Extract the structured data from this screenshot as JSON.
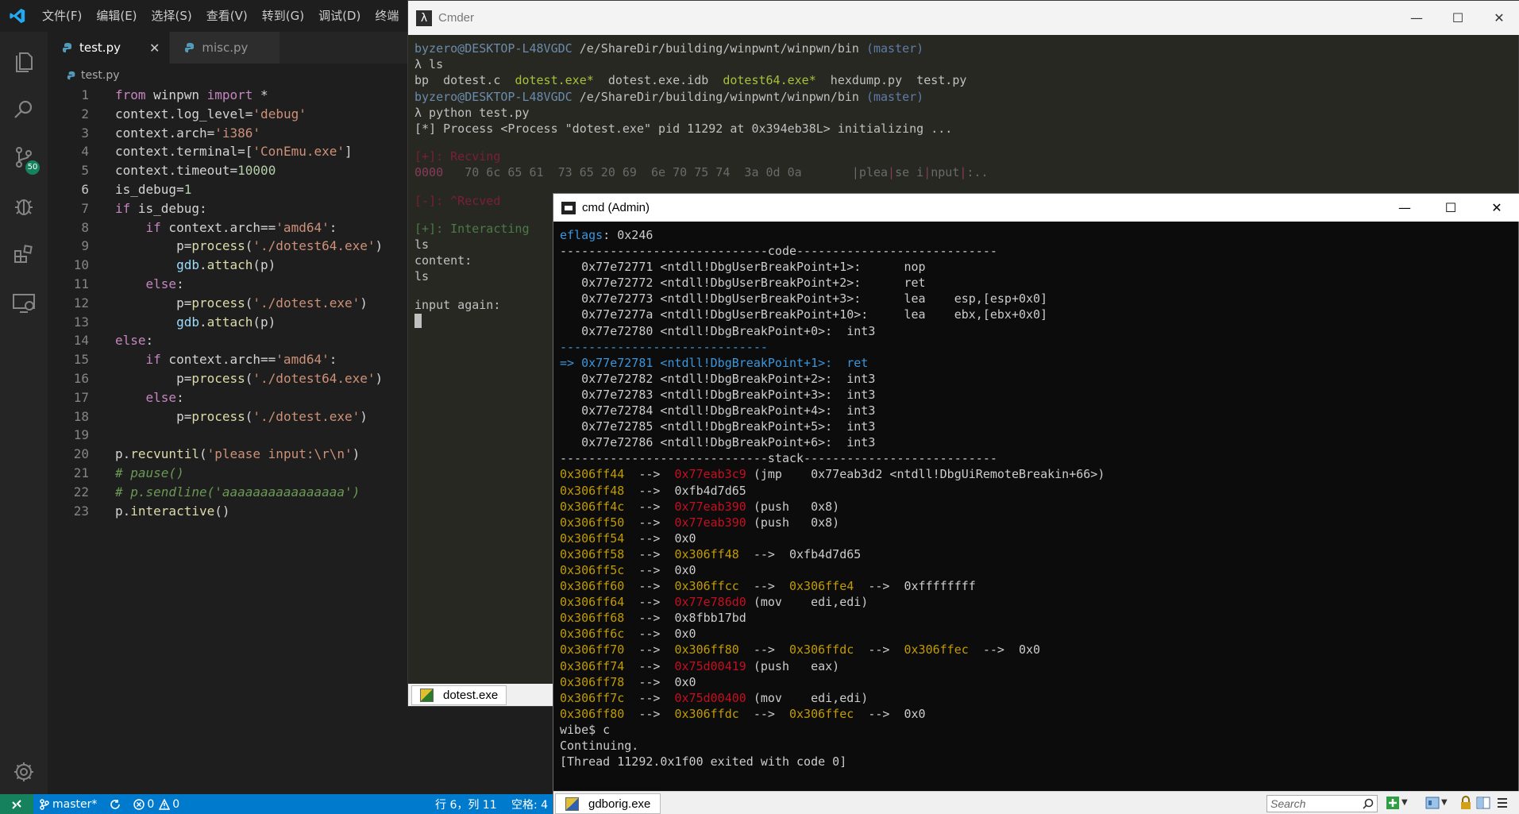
{
  "vscode": {
    "menu": [
      "文件(F)",
      "编辑(E)",
      "选择(S)",
      "查看(V)",
      "转到(G)",
      "调试(D)",
      "终端"
    ],
    "tabs": [
      {
        "label": "test.py",
        "active": true
      },
      {
        "label": "misc.py",
        "active": false
      }
    ],
    "breadcrumb": "test.py",
    "scm_badge": "50",
    "line_numbers": [
      "1",
      "2",
      "3",
      "4",
      "5",
      "6",
      "7",
      "8",
      "9",
      "10",
      "11",
      "12",
      "13",
      "14",
      "15",
      "16",
      "17",
      "18",
      "19",
      "20",
      "21",
      "22",
      "23"
    ],
    "current_line": "6",
    "status": {
      "branch": "master*",
      "errors": "0",
      "warnings": "0",
      "position": "行 6，列 11",
      "spaces": "空格: 4"
    }
  },
  "cmder": {
    "title": "Cmder",
    "lines": [
      {
        "segs": [
          [
            "byzero@DESKTOP-L48VGDC",
            "cg"
          ],
          [
            " /e/ShareDir/building/winpwnt/winpwn/bin ",
            "cpath"
          ],
          [
            "(master)",
            "cbranch"
          ]
        ]
      },
      {
        "segs": [
          [
            "λ ls",
            ""
          ]
        ]
      },
      {
        "segs": [
          [
            "bp  dotest.c  ",
            ""
          ],
          [
            "dotest.exe*",
            "cexe"
          ],
          [
            "  dotest.exe.idb  ",
            ""
          ],
          [
            "dotest64.exe*",
            "cexe"
          ],
          [
            "  hexdump.py  test.py",
            ""
          ]
        ]
      },
      {
        "segs": [
          [
            "byzero@DESKTOP-L48VGDC",
            "cg"
          ],
          [
            " /e/ShareDir/building/winpwnt/winpwn/bin ",
            "cpath"
          ],
          [
            "(master)",
            "cbranch"
          ]
        ]
      },
      {
        "segs": [
          [
            "λ python test.py",
            ""
          ]
        ]
      },
      {
        "segs": [
          [
            "[*] Process <Process \"dotest.exe\" pid 11292 at 0x394eb38L> initializing ...",
            ""
          ]
        ]
      },
      {
        "segs": [
          [
            "",
            ""
          ]
        ]
      },
      {
        "segs": [
          [
            "[+]: Recving",
            "cred"
          ]
        ]
      },
      {
        "segs": [
          [
            "0000   ",
            "cpink"
          ],
          [
            "70 6c 65 61  73 65 20 69  6e 70 75 74  3a 0d 0a",
            "cdim"
          ],
          [
            "       |",
            "cdim"
          ],
          [
            "plea",
            "cdim"
          ],
          [
            "|",
            "cpink"
          ],
          [
            "se i",
            "cdim"
          ],
          [
            "|",
            "cpink"
          ],
          [
            "nput",
            "cdim"
          ],
          [
            "|",
            "cpink"
          ],
          [
            ":..",
            "cdim"
          ]
        ]
      },
      {
        "segs": [
          [
            "",
            ""
          ]
        ]
      },
      {
        "segs": [
          [
            "[-]: ^Recved",
            "cred"
          ]
        ]
      },
      {
        "segs": [
          [
            "",
            ""
          ]
        ]
      },
      {
        "segs": [
          [
            "[+]: Interacting",
            "cgr"
          ]
        ]
      },
      {
        "segs": [
          [
            "ls",
            ""
          ]
        ]
      },
      {
        "segs": [
          [
            "content:",
            ""
          ]
        ]
      },
      {
        "segs": [
          [
            "ls",
            ""
          ]
        ]
      },
      {
        "segs": [
          [
            "",
            ""
          ]
        ]
      },
      {
        "segs": [
          [
            "input again:",
            ""
          ]
        ]
      }
    ],
    "tab_label": "dotest.exe"
  },
  "cmd": {
    "title": "cmd (Admin)",
    "lines": [
      {
        "segs": [
          [
            "eflags",
            "gblue"
          ],
          [
            ": 0x246",
            ""
          ]
        ]
      },
      {
        "segs": [
          [
            "-----------------------------code----------------------------",
            ""
          ]
        ]
      },
      {
        "segs": [
          [
            "   0x77e72771 <ntdll!DbgUserBreakPoint+1>:      nop",
            ""
          ]
        ]
      },
      {
        "segs": [
          [
            "   0x77e72772 <ntdll!DbgUserBreakPoint+2>:      ret",
            ""
          ]
        ]
      },
      {
        "segs": [
          [
            "   0x77e72773 <ntdll!DbgUserBreakPoint+3>:      lea    esp,[esp+0x0]",
            ""
          ]
        ]
      },
      {
        "segs": [
          [
            "   0x77e7277a <ntdll!DbgUserBreakPoint+10>:     lea    ebx,[ebx+0x0]",
            ""
          ]
        ]
      },
      {
        "segs": [
          [
            "   0x77e72780 <ntdll!DbgBreakPoint+0>:  int3",
            ""
          ]
        ]
      },
      {
        "segs": [
          [
            "-----------------------------",
            "gblue"
          ]
        ]
      },
      {
        "segs": [
          [
            "=> 0x77e72781 <ntdll!DbgBreakPoint+1>:  ret",
            "gcy"
          ]
        ]
      },
      {
        "segs": [
          [
            "   0x77e72782 <ntdll!DbgBreakPoint+2>:  int3",
            ""
          ]
        ]
      },
      {
        "segs": [
          [
            "   0x77e72783 <ntdll!DbgBreakPoint+3>:  int3",
            ""
          ]
        ]
      },
      {
        "segs": [
          [
            "   0x77e72784 <ntdll!DbgBreakPoint+4>:  int3",
            ""
          ]
        ]
      },
      {
        "segs": [
          [
            "   0x77e72785 <ntdll!DbgBreakPoint+5>:  int3",
            ""
          ]
        ]
      },
      {
        "segs": [
          [
            "   0x77e72786 <ntdll!DbgBreakPoint+6>:  int3",
            ""
          ]
        ]
      },
      {
        "segs": [
          [
            "-----------------------------stack---------------------------",
            ""
          ]
        ]
      },
      {
        "segs": [
          [
            "0x306ff44",
            "gy"
          ],
          [
            "  -->  ",
            ""
          ],
          [
            "0x77eab3c9",
            "gr"
          ],
          [
            " (jmp    0x77eab3d2 <ntdll!DbgUiRemoteBreakin+66>)",
            ""
          ]
        ]
      },
      {
        "segs": [
          [
            "0x306ff48",
            "gy"
          ],
          [
            "  -->  0xfb4d7d65",
            ""
          ]
        ]
      },
      {
        "segs": [
          [
            "0x306ff4c",
            "gy"
          ],
          [
            "  -->  ",
            ""
          ],
          [
            "0x77eab390",
            "gr"
          ],
          [
            " (push   0x8)",
            ""
          ]
        ]
      },
      {
        "segs": [
          [
            "0x306ff50",
            "gy"
          ],
          [
            "  -->  ",
            ""
          ],
          [
            "0x77eab390",
            "gr"
          ],
          [
            " (push   0x8)",
            ""
          ]
        ]
      },
      {
        "segs": [
          [
            "0x306ff54",
            "gy"
          ],
          [
            "  -->  0x0",
            ""
          ]
        ]
      },
      {
        "segs": [
          [
            "0x306ff58",
            "gy"
          ],
          [
            "  -->  ",
            ""
          ],
          [
            "0x306ff48",
            "gy"
          ],
          [
            "  -->  0xfb4d7d65",
            ""
          ]
        ]
      },
      {
        "segs": [
          [
            "0x306ff5c",
            "gy"
          ],
          [
            "  -->  0x0",
            ""
          ]
        ]
      },
      {
        "segs": [
          [
            "0x306ff60",
            "gy"
          ],
          [
            "  -->  ",
            ""
          ],
          [
            "0x306ffcc",
            "gy"
          ],
          [
            "  -->  ",
            ""
          ],
          [
            "0x306ffe4",
            "gy"
          ],
          [
            "  -->  0xffffffff",
            ""
          ]
        ]
      },
      {
        "segs": [
          [
            "0x306ff64",
            "gy"
          ],
          [
            "  -->  ",
            ""
          ],
          [
            "0x77e786d0",
            "gr"
          ],
          [
            " (mov    edi,edi)",
            ""
          ]
        ]
      },
      {
        "segs": [
          [
            "0x306ff68",
            "gy"
          ],
          [
            "  -->  0x8fbb17bd",
            ""
          ]
        ]
      },
      {
        "segs": [
          [
            "0x306ff6c",
            "gy"
          ],
          [
            "  -->  0x0",
            ""
          ]
        ]
      },
      {
        "segs": [
          [
            "0x306ff70",
            "gy"
          ],
          [
            "  -->  ",
            ""
          ],
          [
            "0x306ff80",
            "gy"
          ],
          [
            "  -->  ",
            ""
          ],
          [
            "0x306ffdc",
            "gy"
          ],
          [
            "  -->  ",
            ""
          ],
          [
            "0x306ffec",
            "gy"
          ],
          [
            "  -->  0x0",
            ""
          ]
        ]
      },
      {
        "segs": [
          [
            "0x306ff74",
            "gy"
          ],
          [
            "  -->  ",
            ""
          ],
          [
            "0x75d00419",
            "gr"
          ],
          [
            " (push   eax)",
            ""
          ]
        ]
      },
      {
        "segs": [
          [
            "0x306ff78",
            "gy"
          ],
          [
            "  -->  0x0",
            ""
          ]
        ]
      },
      {
        "segs": [
          [
            "0x306ff7c",
            "gy"
          ],
          [
            "  -->  ",
            ""
          ],
          [
            "0x75d00400",
            "gr"
          ],
          [
            " (mov    edi,edi)",
            ""
          ]
        ]
      },
      {
        "segs": [
          [
            "0x306ff80",
            "gy"
          ],
          [
            "  -->  ",
            ""
          ],
          [
            "0x306ffdc",
            "gy"
          ],
          [
            "  -->  ",
            ""
          ],
          [
            "0x306ffec",
            "gy"
          ],
          [
            "  -->  0x0",
            ""
          ]
        ]
      },
      {
        "segs": [
          [
            "wibe$ c",
            ""
          ]
        ]
      },
      {
        "segs": [
          [
            "Continuing.",
            ""
          ]
        ]
      },
      {
        "segs": [
          [
            "[Thread 11292.0x1f00 exited with code 0]",
            ""
          ]
        ]
      }
    ],
    "tab_label": "gdborig.exe",
    "search_placeholder": "Search"
  },
  "colors": {
    "vscode_bg": "#1e1e1e",
    "statusbar": "#007acc",
    "cmder_bg": "#272822",
    "cmd_bg": "#0c0c0c"
  }
}
